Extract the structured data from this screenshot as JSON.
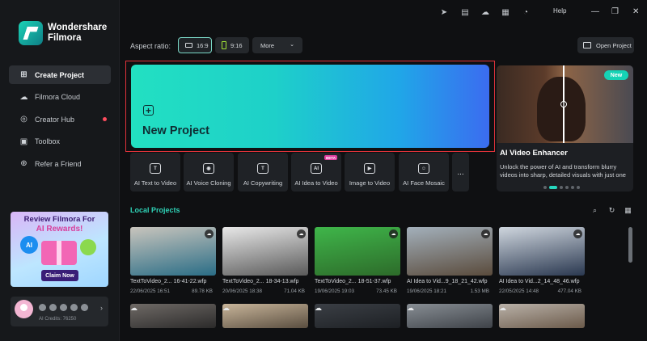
{
  "app": {
    "brand_line1": "Wondershare",
    "brand_line2": "Filmora"
  },
  "sidebar": {
    "items": [
      {
        "label": "Create Project",
        "icon": "create-project-icon",
        "active": true
      },
      {
        "label": "Filmora Cloud",
        "icon": "cloud-icon"
      },
      {
        "label": "Creator Hub",
        "icon": "location-icon",
        "dot": true
      },
      {
        "label": "Toolbox",
        "icon": "toolbox-icon"
      },
      {
        "label": "Refer a Friend",
        "icon": "gift-icon"
      }
    ],
    "promo": {
      "title": "Review Filmora For",
      "subtitle": "AI Rewards!",
      "ai_badge": "AI",
      "button": "Claim Now"
    },
    "credits": "AI Credits: 76250"
  },
  "topbar": {
    "help": "Help"
  },
  "aspect": {
    "label": "Aspect ratio:",
    "options": [
      "16:9",
      "9:16"
    ],
    "selected": "16:9",
    "more": "More",
    "open_project": "Open Project"
  },
  "new_project": {
    "label": "New Project"
  },
  "featured": {
    "badge": "New",
    "title": "AI Video Enhancer",
    "description": "Unlock the power of AI and transform blurry videos into sharp, detailed visuals with just one"
  },
  "tools": [
    {
      "label": "AI Text to Video",
      "glyph": "T"
    },
    {
      "label": "AI Voice Cloning",
      "glyph": "◉"
    },
    {
      "label": "AI Copywriting",
      "glyph": "T"
    },
    {
      "label": "AI Idea to Video",
      "glyph": "AI",
      "badge": "BETA"
    },
    {
      "label": "Image to Video",
      "glyph": "▶"
    },
    {
      "label": "AI Face Mosaic",
      "glyph": "☺"
    }
  ],
  "tools_more": "...",
  "local_projects": {
    "title": "Local Projects",
    "items": [
      {
        "name": "TextToVideo_2... 16-41-22.wfp",
        "date": "22/06/2025 16:51",
        "size": "89.78 KB",
        "colors": [
          "#c9c5bd",
          "#2a6d86"
        ]
      },
      {
        "name": "TextToVideo_2... 18-34-13.wfp",
        "date": "20/06/2025 18:38",
        "size": "71.04 KB",
        "colors": [
          "#e8e8e8",
          "#5a5a5a"
        ]
      },
      {
        "name": "TextToVideo_2... 18-51-37.wfp",
        "date": "19/06/2025 19:03",
        "size": "73.45 KB",
        "colors": [
          "#3fb64a",
          "#2d6b2a"
        ]
      },
      {
        "name": "AI Idea to Vid...9_18_21_42.wfp",
        "date": "19/06/2025 18:21",
        "size": "1.53 MB",
        "colors": [
          "#a3b0bb",
          "#5a4b3c"
        ]
      },
      {
        "name": "AI Idea to Vid...2_14_48_46.wfp",
        "date": "22/05/2025 14:48",
        "size": "477.04 KB",
        "colors": [
          "#cfd6de",
          "#2a3850"
        ]
      }
    ],
    "row2_colors": [
      [
        "#6f6a66",
        "#2b2a2a"
      ],
      [
        "#c8b59a",
        "#5a4e40"
      ],
      [
        "#3b3f45",
        "#1d2024"
      ],
      [
        "#888e94",
        "#3e4248"
      ],
      [
        "#b9b1a8",
        "#6b5a4a"
      ]
    ]
  }
}
